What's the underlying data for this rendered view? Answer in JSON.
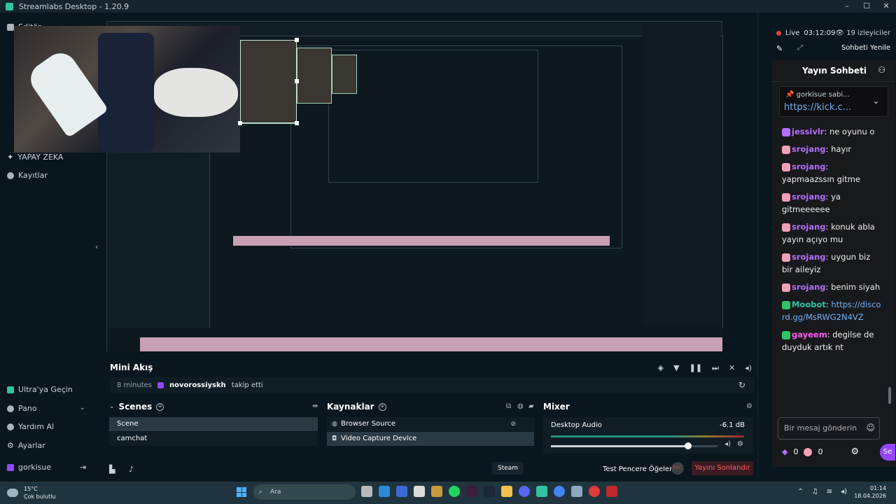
{
  "window": {
    "title": "Streamlabs Desktop - 1.20.9"
  },
  "nav": {
    "items": [
      {
        "label": "Editör"
      },
      {
        "label": "YAPAY ZEKA"
      },
      {
        "label": "Kayıtlar"
      }
    ],
    "bottom_items": [
      {
        "label": "Ultra'ya Geçin"
      },
      {
        "label": "Pano"
      },
      {
        "label": "Yardım Al"
      },
      {
        "label": "Ayarlar"
      },
      {
        "label": "gorkisue"
      }
    ]
  },
  "mini_feed": {
    "title": "Mini Akış",
    "event": {
      "time": "8 minutes",
      "user": "novorossiyskh",
      "text": "takip etti"
    }
  },
  "scenes": {
    "title": "Scenes",
    "items": [
      "Scene",
      "camchat"
    ]
  },
  "sources": {
    "title": "Kaynaklar",
    "items": [
      "Browser Source",
      "Video Capture Device"
    ]
  },
  "mixer": {
    "title": "Mixer",
    "label": "Desktop Audio",
    "db": "-6.1 dB",
    "volume_fraction": 0.82
  },
  "footer": {
    "studio_mode": "Steam",
    "test_label": "Test Pencere Öğeleri",
    "rec_label": "REC",
    "end_button": "Yayını Sonlandır"
  },
  "chat_panel": {
    "live_label": "Live",
    "live_time": "03:12:09",
    "viewers": "19 izleyiciler",
    "refresh": "Sohbeti Yenile",
    "chat_title": "Yayın Sohbeti",
    "pinned_user": "gorkisue sabi...",
    "pinned_link": "https://kick.c...",
    "messages": [
      {
        "user": "jessivlr",
        "text": "ne oyunu o",
        "color": "#b46fff"
      },
      {
        "user": "srojang",
        "text": "hayır",
        "color": "#b46fff"
      },
      {
        "user": "srojang",
        "text": "yapmaazssın gitme",
        "color": "#b46fff"
      },
      {
        "user": "srojang",
        "text": "ya gitmeeeeee",
        "color": "#b46fff"
      },
      {
        "user": "srojang",
        "text": "konuk abla yayın açıyo mu",
        "color": "#b46fff"
      },
      {
        "user": "srojang",
        "text": "uygun biz bir aileyiz",
        "color": "#b46fff"
      },
      {
        "user": "srojang",
        "text": "benim siyah",
        "color": "#b46fff"
      },
      {
        "user": "Moobot",
        "text": "https://discord.gg/MsRWG2N4VZ",
        "color": "#31c3a2"
      },
      {
        "user": "gayeem",
        "text": "degilse de duyduk artık nt",
        "color": "#ff5cf3"
      }
    ],
    "input_placeholder": "Bir mesaj gönderin",
    "points_a": "0",
    "points_b": "0",
    "send_label": "Se"
  },
  "taskbar": {
    "temp": "15°C",
    "weather": "Çok bulutlu",
    "search": "Ara",
    "time": "01:14",
    "date": "18.04.2026"
  },
  "colors": {
    "accent": "#31c3a2",
    "bg": "#09161d",
    "twitch": "#9147ff",
    "danger": "#ff5c5c"
  }
}
